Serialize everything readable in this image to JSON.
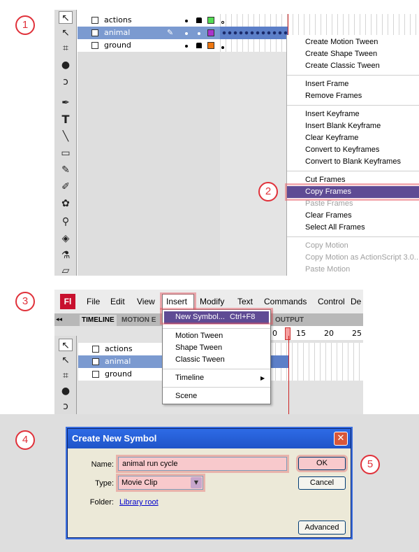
{
  "steps": [
    "1",
    "2",
    "3",
    "4",
    "5"
  ],
  "section1": {
    "layers": [
      {
        "name": "actions",
        "swatch": "#55dd55"
      },
      {
        "name": "animal",
        "swatch": "#aa33cc"
      },
      {
        "name": "ground",
        "swatch": "#ee7711"
      }
    ],
    "context_menu": [
      {
        "label": "Create Motion Tween",
        "enabled": true
      },
      {
        "label": "Create Shape Tween",
        "enabled": true
      },
      {
        "label": "Create Classic Tween",
        "enabled": true
      },
      {
        "label": "Insert Frame",
        "enabled": true
      },
      {
        "label": "Remove Frames",
        "enabled": true
      },
      {
        "label": "Insert Keyframe",
        "enabled": true
      },
      {
        "label": "Insert Blank Keyframe",
        "enabled": true
      },
      {
        "label": "Clear Keyframe",
        "enabled": true
      },
      {
        "label": "Convert to Keyframes",
        "enabled": true
      },
      {
        "label": "Convert to Blank Keyframes",
        "enabled": true
      },
      {
        "label": "Cut Frames",
        "enabled": true
      },
      {
        "label": "Copy Frames",
        "enabled": true
      },
      {
        "label": "Paste Frames",
        "enabled": false
      },
      {
        "label": "Clear Frames",
        "enabled": true
      },
      {
        "label": "Select All Frames",
        "enabled": true
      },
      {
        "label": "Copy Motion",
        "enabled": false
      },
      {
        "label": "Copy Motion as ActionScript 3.0...",
        "enabled": false
      },
      {
        "label": "Paste Motion",
        "enabled": false
      }
    ]
  },
  "section2": {
    "app_logo": "Fl",
    "menubar": [
      "File",
      "Edit",
      "View",
      "Insert",
      "Modify",
      "Text",
      "Commands",
      "Control",
      "De"
    ],
    "panel_tabs": [
      "TIMELINE",
      "MOTION E",
      "OUTPUT"
    ],
    "frame_numbers": [
      "0",
      "15",
      "20",
      "25"
    ],
    "layers": [
      "actions",
      "animal",
      "ground"
    ],
    "insert_menu": {
      "highlighted": "New Symbol...",
      "shortcut": "Ctrl+F8",
      "items": [
        "Motion Tween",
        "Shape Tween",
        "Classic Tween",
        "Timeline",
        "Scene"
      ]
    }
  },
  "dialog": {
    "title": "Create New Symbol",
    "close_glyph": "✕",
    "name_label": "Name:",
    "name_value": "animal run cycle",
    "type_label": "Type:",
    "type_value": "Movie Clip",
    "folder_label": "Folder:",
    "folder_value": "Library root",
    "ok_label": "OK",
    "cancel_label": "Cancel",
    "advanced_label": "Advanced"
  },
  "colors": {
    "accent_red": "#e0313a",
    "selection_purple": "#5f4b94",
    "layer_selected": "#7b9ad0",
    "dialog_bg": "#ece9d8",
    "xp_title": "#2e6be6"
  }
}
